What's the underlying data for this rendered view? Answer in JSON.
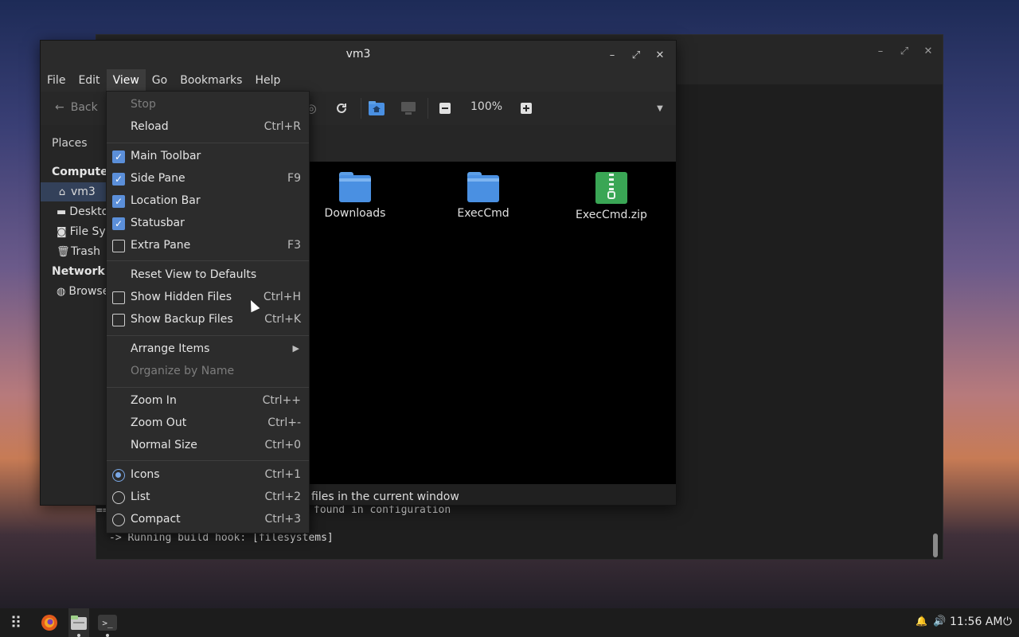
{
  "terminal": {
    "lines": [
      "==",
      "found in configuration",
      "-> Running build hook: [filesystems]"
    ],
    "controls": {
      "minimize": "–",
      "maximize": "⤢",
      "close": "✕"
    }
  },
  "window": {
    "title": "vm3",
    "controls": {
      "minimize": "–",
      "maximize": "⤢",
      "close": "✕"
    }
  },
  "menubar": {
    "file": "File",
    "edit": "Edit",
    "view": "View",
    "go": "Go",
    "bookmarks": "Bookmarks",
    "help": "Help"
  },
  "toolbar": {
    "back_label": "Back",
    "back_icon": "←",
    "zoom_level": "100%",
    "dropdown_icon": "▼"
  },
  "sidebar": {
    "places_label": "Places",
    "computer_header": "Computer",
    "network_header": "Network",
    "items": [
      {
        "icon": "⌂",
        "label": "vm3"
      },
      {
        "icon": "▬",
        "label": "Desktop"
      },
      {
        "icon": "◙",
        "label": "File System"
      },
      {
        "icon": "🗑",
        "label": "Trash"
      },
      {
        "icon": "◍",
        "label": "Browse Network"
      }
    ]
  },
  "files": [
    {
      "name": "Downloads",
      "type": "folder"
    },
    {
      "name": "ExecCmd",
      "type": "folder"
    },
    {
      "name": "ExecCmd.zip",
      "type": "zip"
    }
  ],
  "statusbar": {
    "text": "files in the current window"
  },
  "view_menu": {
    "stop": {
      "label": "Stop"
    },
    "reload": {
      "label": "Reload",
      "shortcut": "Ctrl+R"
    },
    "main_toolbar": {
      "label": "Main Toolbar",
      "checked": true
    },
    "side_pane": {
      "label": "Side Pane",
      "shortcut": "F9",
      "checked": true
    },
    "location_bar": {
      "label": "Location Bar",
      "checked": true
    },
    "statusbar": {
      "label": "Statusbar",
      "checked": true
    },
    "extra_pane": {
      "label": "Extra Pane",
      "shortcut": "F3",
      "checked": false
    },
    "reset_view": {
      "label": "Reset View to Defaults"
    },
    "show_hidden": {
      "label": "Show Hidden Files",
      "shortcut": "Ctrl+H",
      "checked": false
    },
    "show_backup": {
      "label": "Show Backup Files",
      "shortcut": "Ctrl+K",
      "checked": false
    },
    "arrange_items": {
      "label": "Arrange Items",
      "arrow": "▶"
    },
    "organize_by_name": {
      "label": "Organize by Name"
    },
    "zoom_in": {
      "label": "Zoom In",
      "shortcut": "Ctrl++"
    },
    "zoom_out": {
      "label": "Zoom Out",
      "shortcut": "Ctrl+-"
    },
    "normal_size": {
      "label": "Normal Size",
      "shortcut": "Ctrl+0"
    },
    "icons": {
      "label": "Icons",
      "shortcut": "Ctrl+1",
      "selected": true
    },
    "list": {
      "label": "List",
      "shortcut": "Ctrl+2",
      "selected": false
    },
    "compact": {
      "label": "Compact",
      "shortcut": "Ctrl+3",
      "selected": false
    }
  },
  "taskbar": {
    "clock": "11:56 AM",
    "apps_icon": "⠿",
    "bell_icon": "🔔",
    "volume_icon": "🔊",
    "power_icon": "⏻",
    "terminal_icon": ">_"
  },
  "colors": {
    "accent": "#5b8fd9",
    "folder": "#4a90e2",
    "zip": "#3aa655"
  }
}
